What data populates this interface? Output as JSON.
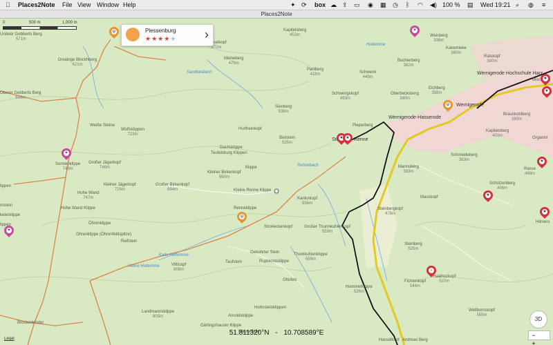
{
  "menubar": {
    "app": "Places2Note",
    "menus": [
      "File",
      "View",
      "Window",
      "Help"
    ],
    "status": {
      "battery": "100 %",
      "clock": "Wed 19:21"
    }
  },
  "window": {
    "title": "Places2Note"
  },
  "scale": {
    "zero": "0",
    "left": "500 m",
    "right": "1,000 m"
  },
  "popup": {
    "title": "Plessenburg",
    "rating": 4,
    "max": 5
  },
  "coords": {
    "lat": "51.811320°N",
    "sep": "-",
    "lon": "10.708589°E"
  },
  "controls": {
    "btn3d": "3D",
    "zoom_out": "−",
    "zoom_in": "+",
    "legal": "Legal"
  },
  "labels": [
    {
      "n": "Unterer Gebberts Berg",
      "e": "571m"
    },
    {
      "n": "Dreiänge Blockhberg",
      "e": "621m"
    },
    {
      "n": "Oberer Gebberts Berg",
      "e": "649m"
    },
    {
      "n": "Weiße Steine",
      "e": ""
    },
    {
      "n": "Wolfsklippen",
      "e": "723m"
    },
    {
      "n": "Sonnenklippe",
      "e": "749m"
    },
    {
      "n": "Großer Jägerkopf",
      "e": "746m"
    },
    {
      "n": "Hohe Wand",
      "e": "747m"
    },
    {
      "n": "Kleiner Jägerkopf",
      "e": "726m"
    },
    {
      "n": "Großer Birkenkopf",
      "e": "664m"
    },
    {
      "n": "Hohe Wand Klippe",
      "e": ""
    },
    {
      "n": "Öhrenklippe",
      "e": ""
    },
    {
      "n": "Öhrenklippe (Öhrenfeldspitze)",
      "e": ""
    },
    {
      "n": "Reifstein",
      "e": ""
    },
    {
      "n": "Vitticopf",
      "e": "608m"
    },
    {
      "n": "Landmannsklippe",
      "e": "805m"
    },
    {
      "n": "Brockenkinder",
      "e": ""
    },
    {
      "n": "Kapitelsberg",
      "e": "452m"
    },
    {
      "n": "Hasselkopf",
      "e": "572m"
    },
    {
      "n": "Meineberg",
      "e": "476m"
    },
    {
      "n": "Pahlberg",
      "e": "418m"
    },
    {
      "n": "Schwenk",
      "e": "449m"
    },
    {
      "n": "Schwengskopf",
      "e": "493m"
    },
    {
      "n": "Sienberg",
      "e": "538m"
    },
    {
      "n": "Hurlheinkopf",
      "e": ""
    },
    {
      "n": "Bielstein",
      "e": "525m"
    },
    {
      "n": "Dachsklippe",
      "e": ""
    },
    {
      "n": "Teufelsburg Klippen",
      "e": ""
    },
    {
      "n": "Klippe",
      "e": ""
    },
    {
      "n": "Kleiner Birkenkopf",
      "e": "590m"
    },
    {
      "n": "Kleine Renne Klippe",
      "e": ""
    },
    {
      "n": "Kantorkopf",
      "e": "556m"
    },
    {
      "n": "Renneklippe",
      "e": ""
    },
    {
      "n": "Stroileckenkopf",
      "e": ""
    },
    {
      "n": "Großer Thurmkuhlenkopf",
      "e": "559m"
    },
    {
      "n": "Gebohrter Stein",
      "e": ""
    },
    {
      "n": "Ruprechtsklippe",
      "e": ""
    },
    {
      "n": "Taufstein",
      "e": ""
    },
    {
      "n": "Thumkuhlenklippe",
      "e": "559m"
    },
    {
      "n": "Ottofels",
      "e": ""
    },
    {
      "n": "Hammerklippe",
      "e": "526m"
    },
    {
      "n": "Hohnsteinklippen",
      "e": ""
    },
    {
      "n": "Arnoldsklippe",
      "e": ""
    },
    {
      "n": "Gärlingshauser Klippe",
      "e": ""
    },
    {
      "n": "Mauseffalle",
      "e": ""
    },
    {
      "n": "Weinberg",
      "e": "336m"
    },
    {
      "n": "Kakemieke",
      "e": "380m"
    },
    {
      "n": "Ratskopf",
      "e": "340m"
    },
    {
      "n": "Oberbecksberg",
      "e": "380m"
    },
    {
      "n": "Eichberg",
      "e": "358m"
    },
    {
      "n": "Buchenberg",
      "e": "382m"
    },
    {
      "n": "Braunkohlberg",
      "e": "380m"
    },
    {
      "n": "Kapitelsberg",
      "e": "403m"
    },
    {
      "n": "Schmiedeberg",
      "e": "383m"
    },
    {
      "n": "Mannsberg",
      "e": "383m"
    },
    {
      "n": "Masskopf",
      "e": ""
    },
    {
      "n": "Schützenberg",
      "e": "406m"
    },
    {
      "n": "Steinbergkopf",
      "e": "478m"
    },
    {
      "n": "Steinberg",
      "e": "525m"
    },
    {
      "n": "Fichtenkopf",
      "e": "544m"
    },
    {
      "n": "Haalhozkopf",
      "e": "537m"
    },
    {
      "n": "Wellbornskopf",
      "e": "555m"
    },
    {
      "n": "Hasselkopf",
      "e": ""
    },
    {
      "n": "Andreas Berg",
      "e": ""
    },
    {
      "n": "Organist",
      "e": ""
    },
    {
      "n": "Hilmers",
      "e": ""
    },
    {
      "n": "Rasse",
      "e": "448m"
    },
    {
      "n": "Blocksb",
      "e": ""
    },
    {
      "n": "rnstein",
      "e": ""
    },
    {
      "n": "lippen",
      "e": ""
    },
    {
      "n": "keterklippe",
      "e": ""
    },
    {
      "n": "lippen",
      "e": ""
    }
  ],
  "towns": [
    {
      "n": "Wernigerode Hochschule Harz"
    },
    {
      "n": "Wernigerode-Hasserode"
    },
    {
      "n": "Wernigerode"
    },
    {
      "n": "Pieperberg"
    },
    {
      "n": "Steinerne Renne"
    }
  ],
  "streams": [
    "Sandtalsbach",
    "Holtemme",
    "Kalte Holtemme",
    "Kleine Holtemme",
    "Rehnebach"
  ]
}
